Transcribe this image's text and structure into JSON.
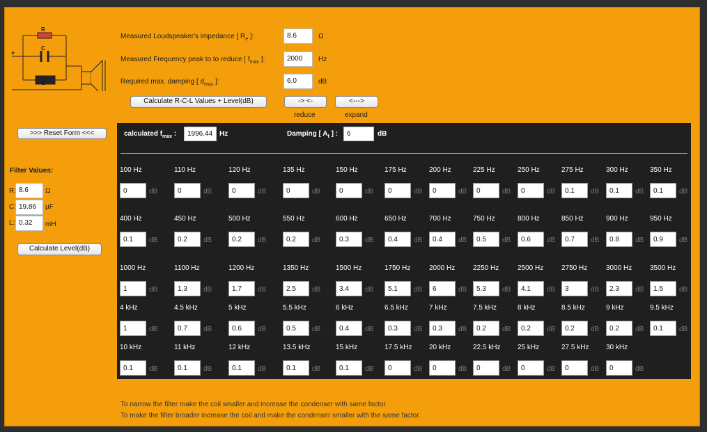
{
  "params": {
    "impedance": {
      "label_pre": "Measured Loudspeaker's impedance [ R",
      "label_sub": "e",
      "label_post": " ]:",
      "value": "8.6",
      "unit": "Ω"
    },
    "freq_peak": {
      "label_pre": "Measured Frequency peak to to reduce [ f",
      "label_sub": "max",
      "label_post": " ]:",
      "value": "2000",
      "unit": "Hz"
    },
    "damping": {
      "label_pre": "Required max. damping [ d",
      "label_sub": "max",
      "label_post": " ]:",
      "value": "6.0",
      "unit": "dB"
    }
  },
  "buttons": {
    "calculate_rcl": "Calculate R-C-L Values + Level(dB)",
    "reduce_symbol": "-> <-",
    "expand_symbol": "<--->",
    "reduce_caption": "reduce",
    "expand_caption": "expand",
    "reset": ">>> Reset Form <<<",
    "calculate_level": "Calculate Level(dB)"
  },
  "circuit_labels": {
    "r": "R",
    "c": "C",
    "l": "L",
    "plus": "+"
  },
  "filter": {
    "title": "Filter Values:",
    "r_label": "R:",
    "r_value": "8.6",
    "r_unit": "Ω",
    "c_label": "C:",
    "c_value": "19.86",
    "c_unit": "µF",
    "l_label": "L:",
    "l_value": "0.32",
    "l_unit": "mH"
  },
  "results": {
    "fmax_pre": "calculated f",
    "fmax_sub": "max",
    "fmax_post": " :",
    "fmax_value": "1996.44",
    "fmax_unit": "Hz",
    "damp_pre": "Damping [ A",
    "damp_sub": "t",
    "damp_post": " ] :",
    "damp_value": "6",
    "damp_unit": "dB"
  },
  "db_unit": "dB",
  "rows": [
    {
      "freqs": [
        "100 Hz",
        "110 Hz",
        "120 Hz",
        "135 Hz",
        "150 Hz",
        "175 Hz",
        "200 Hz",
        "225 Hz",
        "250 Hz",
        "275 Hz",
        "300 Hz",
        "350 Hz"
      ],
      "values": [
        "0",
        "0",
        "0",
        "0",
        "0",
        "0",
        "0",
        "0",
        "0",
        "0.1",
        "0.1",
        "0.1"
      ]
    },
    {
      "freqs": [
        "400 Hz",
        "450 Hz",
        "500 Hz",
        "550 Hz",
        "600 Hz",
        "650 Hz",
        "700 Hz",
        "750 Hz",
        "800 Hz",
        "850 Hz",
        "900 Hz",
        "950 Hz"
      ],
      "values": [
        "0.1",
        "0.2",
        "0.2",
        "0.2",
        "0.3",
        "0.4",
        "0.4",
        "0.5",
        "0.6",
        "0.7",
        "0.8",
        "0.9"
      ]
    },
    {
      "freqs": [
        "1000 Hz",
        "1100 Hz",
        "1200 Hz",
        "1350 Hz",
        "1500 Hz",
        "1750 Hz",
        "2000 Hz",
        "2250 Hz",
        "2500 Hz",
        "2750 Hz",
        "3000 Hz",
        "3500 Hz"
      ],
      "values": [
        "1",
        "1.3",
        "1.7",
        "2.5",
        "3.4",
        "5.1",
        "6",
        "5.3",
        "4.1",
        "3",
        "2.3",
        "1.5"
      ]
    },
    {
      "freqs": [
        "4 kHz",
        "4.5 kHz",
        "5 kHz",
        "5.5 kHz",
        "6 kHz",
        "6.5 kHz",
        "7 kHz",
        "7.5 kHz",
        "8 kHz",
        "8.5 kHz",
        "9 kHz",
        "9.5 kHz"
      ],
      "values": [
        "1",
        "0.7",
        "0.6",
        "0.5",
        "0.4",
        "0.3",
        "0.3",
        "0.2",
        "0.2",
        "0.2",
        "0.2",
        "0.1"
      ]
    },
    {
      "freqs": [
        "10 kHz",
        "11 kHz",
        "12 kHz",
        "13.5 kHz",
        "15 kHz",
        "17.5 kHz",
        "20 kHz",
        "22.5 kHz",
        "25 kHz",
        "27.5 kHz",
        "30 kHz"
      ],
      "values": [
        "0.1",
        "0.1",
        "0.1",
        "0.1",
        "0.1",
        "0",
        "0",
        "0",
        "0",
        "0",
        "0"
      ]
    }
  ],
  "notes": [
    "To narrow the filter make the coil smaller and increase the condenser with same factor.",
    "To make the filter broader increase the coil and make the condenser smaller with the same factor."
  ]
}
